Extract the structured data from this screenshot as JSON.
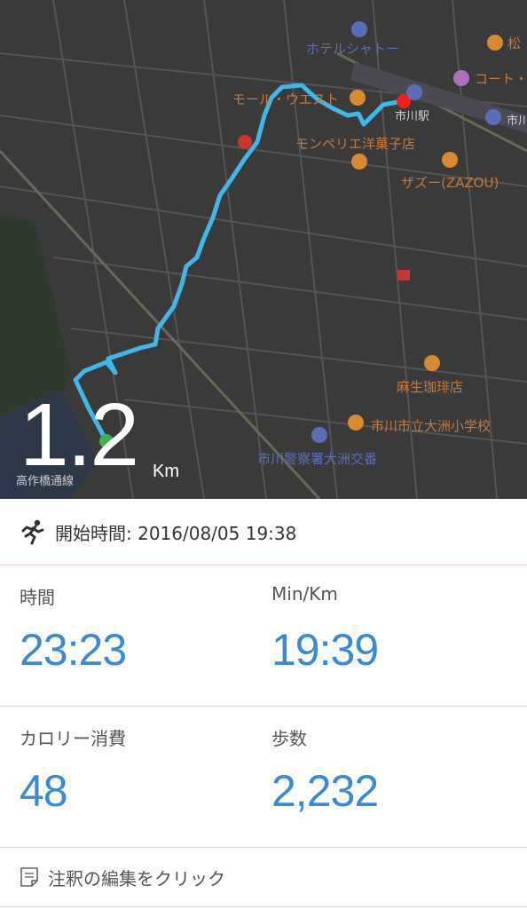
{
  "map": {
    "labels": {
      "hotel": "ホテルシャトー",
      "matsu": "松",
      "coat": "コート・",
      "mall": "モール・ウエスト",
      "station": "市川駅",
      "ichika": "市川",
      "montpellier": "モンペリエ洋菓子店",
      "zazou": "ザズー(ZAZOU)",
      "asao": "麻生珈琲店",
      "school": "市川市立大洲小学校",
      "police": "市川警察署大洲交番",
      "road": "高作橋通線"
    },
    "route_color": "#3cb8ec",
    "start_marker_color": "#3cb44a",
    "end_marker_color": "#ff1a1a"
  },
  "distance": {
    "value": "1.2",
    "unit": "Km"
  },
  "start": {
    "icon": "runner-icon",
    "label": "開始時間: 2016/08/05 19:38"
  },
  "stats": {
    "time": {
      "label": "時間",
      "value": "23:23"
    },
    "pace": {
      "label": "Min/Km",
      "value": "19:39"
    },
    "calories": {
      "label": "カロリー消費",
      "value": "48"
    },
    "steps": {
      "label": "歩数",
      "value": "2,232"
    }
  },
  "note": {
    "icon": "note-icon",
    "label": "注釈の編集をクリック"
  },
  "colors": {
    "accent": "#3a8ad4",
    "map_bg": "#3a3a3a",
    "divider": "#dcdcdc"
  }
}
